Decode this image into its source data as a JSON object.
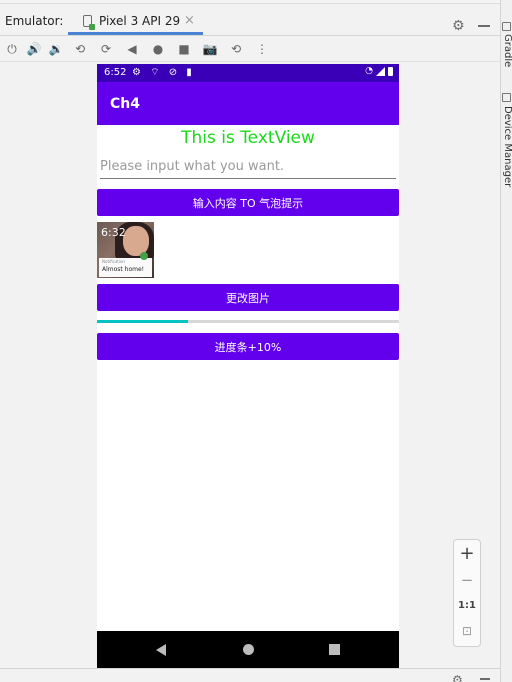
{
  "emulator": {
    "label": "Emulator:",
    "tab_label": "Pixel 3 API 29",
    "tab_close": "×"
  },
  "toolbar": {
    "icons": [
      "power-icon",
      "volume-up-icon",
      "volume-down-icon",
      "rotate-left-icon",
      "rotate-right-icon",
      "back-icon",
      "home-icon",
      "overview-icon",
      "screenshot-icon",
      "snapshot-icon",
      "more-icon"
    ]
  },
  "right_rail": {
    "gradle": "Gradle",
    "device_manager": "Device Manager"
  },
  "device": {
    "status_time": "6:52",
    "app_title": "Ch4",
    "textview": "This is TextView",
    "edit_placeholder": "Please input what you want.",
    "toast_button": "输入内容 TO 气泡提示",
    "image_time": "6:32",
    "image_card_small": "Notification",
    "image_card_text": "Almost home!",
    "change_image_button": "更改图片",
    "progress_percent": 30,
    "progress_button": "进度条+10%"
  },
  "zoom": {
    "zoom_in": "+",
    "zoom_out": "−",
    "actual_size": "1:1"
  },
  "colors": {
    "status_bar": "#3a00b8",
    "app_bar": "#6200ee",
    "button": "#6200ee",
    "textview": "#1ad81a",
    "progress": "#03c2c2"
  }
}
